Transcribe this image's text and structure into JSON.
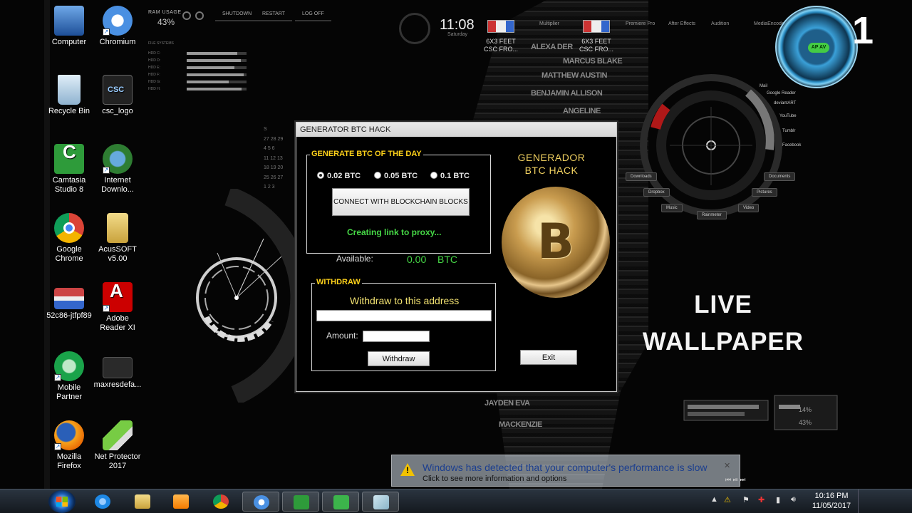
{
  "desktop": {
    "icons": [
      {
        "label": "Computer"
      },
      {
        "label": "Chromium"
      },
      {
        "label": "Recycle Bin"
      },
      {
        "label": "csc_logo"
      },
      {
        "label": "Camtasia Studio 8"
      },
      {
        "label": "Internet Downlo..."
      },
      {
        "label": "Google Chrome"
      },
      {
        "label": "AcusSOFT v5.00"
      },
      {
        "label": "52c86-jtfpf89"
      },
      {
        "label": "Adobe Reader XI"
      },
      {
        "label": "Mobile Partner"
      },
      {
        "label": "maxresdefa..."
      },
      {
        "label": "Mozilla Firefox"
      },
      {
        "label": "Net Protector 2017"
      }
    ],
    "icon_colors": {
      "computer": "#3a7fd0",
      "chromium": "#4a90e2",
      "recycle": "#a8c8e8",
      "csc": "#d8d8d8",
      "camtasia": "#2e9b3a",
      "idm": "#2e7d32",
      "chrome": "#db4437",
      "acussoft": "#e8c860",
      "thumb": "#c44",
      "adobe": "#d11",
      "mobile": "#1aa34a",
      "maxres": "#333",
      "firefox": "#e66000",
      "netprotector": "#7c4"
    }
  },
  "wallpaper": {
    "ram_label": "RAM USAGE",
    "ram_value": "43%",
    "top_buttons": [
      "SHUTDOWN",
      "RESTART",
      "LOG OFF"
    ],
    "clock": "11:08",
    "clock_sub": "Saturday",
    "gadgets": [
      {
        "label": "6X3 FEET CSC FRO..."
      },
      {
        "label": "6X3 FEET CSC FRO..."
      }
    ],
    "link_tabs": [
      "Multiplier",
      "Premiere Pro",
      "After Effects",
      "Audition",
      "MediaEncoder"
    ],
    "fs_title": "FILE SYSTEMS",
    "fs_rows": [
      {
        "label": "HDD C:",
        "fill": 0.85
      },
      {
        "label": "HDD D:",
        "fill": 0.9
      },
      {
        "label": "HDD E:",
        "fill": 0.8
      },
      {
        "label": "HDD F:",
        "fill": 0.95
      },
      {
        "label": "HDD G:",
        "fill": 0.7
      },
      {
        "label": "HDD H:",
        "fill": 0.92
      }
    ],
    "calendar": [
      "S",
      "27 28 29",
      "4 5 6",
      "11 12 13",
      "18 19 20",
      "25 26 27",
      "1 2 3"
    ],
    "radial_links": [
      "Mail",
      "Google Reader",
      "deviantART",
      "YouTube",
      "Tumblr",
      "Facebook"
    ],
    "radial_buttons": [
      "Downloads",
      "Dropbox",
      "Music",
      "Rainmeter",
      "Video",
      "Pictures",
      "Documents"
    ],
    "live_line1": "LIVE",
    "live_line2": "WALLPAPER",
    "ap_badge": "AP AV",
    "edge_digit": "1",
    "perf_cpu": "14%",
    "perf_ram": "43%"
  },
  "dialog": {
    "title": "GENERATOR BTC HACK",
    "group_generate": "GENERATE BTC OF THE DAY",
    "radios": [
      {
        "label": "0.02 BTC",
        "checked": true
      },
      {
        "label": "0.05 BTC",
        "checked": false
      },
      {
        "label": "0.1 BTC",
        "checked": false
      }
    ],
    "connect_button": "CONNECT WITH BLOCKCHAIN BLOCKS",
    "status": "Creating link to proxy...",
    "available_label": "Available:",
    "available_value": "0.00",
    "available_unit": "BTC",
    "side_title_1": "GENERADOR",
    "side_title_2": "BTC HACK",
    "coin_symbol": "B",
    "withdraw_group": "WITHDRAW",
    "withdraw_prompt": "Withdraw to this address",
    "address_value": "",
    "amount_label": "Amount:",
    "amount_value": "",
    "withdraw_button": "Withdraw",
    "exit_button": "Exit"
  },
  "notification": {
    "title": "Windows has detected that your computer's performance is slow",
    "subtitle": "Click to see more information and options",
    "close": "✕"
  },
  "taskbar": {
    "time": "10:16 PM",
    "date": "11/05/2017",
    "items": [
      {
        "name": "internet-explorer",
        "color": "#1e88e5"
      },
      {
        "name": "file-explorer",
        "color": "#e8c050"
      },
      {
        "name": "media-player",
        "color": "#f57c00"
      },
      {
        "name": "chrome",
        "color": "#db4437"
      },
      {
        "name": "chromium",
        "color": "#4a90e2"
      },
      {
        "name": "camtasia-1",
        "color": "#2e9b3a"
      },
      {
        "name": "camtasia-2",
        "color": "#3cb44b"
      },
      {
        "name": "generator",
        "color": "#8ab4c8"
      }
    ]
  }
}
